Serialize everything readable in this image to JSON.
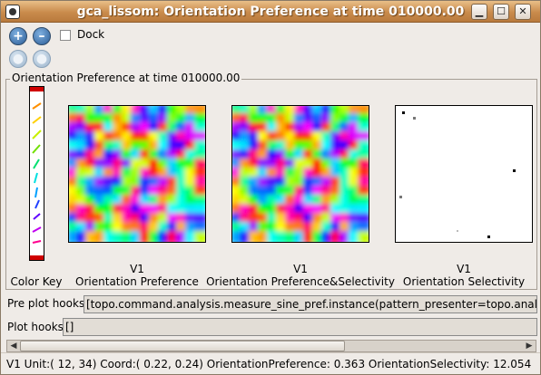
{
  "window": {
    "title": "gca_lissom: Orientation Preference at time 010000.00",
    "app_icon": "app-icon",
    "buttons": [
      "minimize-icon",
      "maximize-icon",
      "close-icon"
    ]
  },
  "toolbar": {
    "zoom_in_icon": "zoom-in-icon",
    "zoom_out_icon": "zoom-out-icon",
    "dock_label": "Dock",
    "dock_checked": false
  },
  "group": {
    "title": "Orientation Preference at time 010000.00"
  },
  "plots": {
    "color_key_label": "Color Key",
    "items": [
      {
        "line1": "V1",
        "line2": "Orientation Preference"
      },
      {
        "line1": "V1",
        "line2": "Orientation Preference&Selectivity"
      },
      {
        "line1": "V1",
        "line2": "Orientation Selectivity"
      }
    ]
  },
  "hooks": {
    "pre_label": "Pre plot hooks",
    "pre_value": "[topo.command.analysis.measure_sine_pref.instance(pattern_presenter=topo.analysis.featureresponses",
    "plot_label": "Plot hooks",
    "plot_value": "[]"
  },
  "status": {
    "text": "V1 Unit:( 12, 34) Coord:( 0.22, 0.24) OrientationPreference:  0.363 OrientationSelectivity:  12.054"
  }
}
